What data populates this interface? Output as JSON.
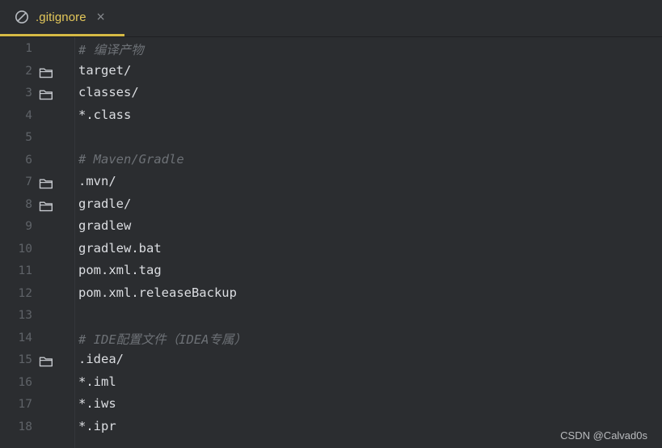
{
  "editor": {
    "tab": {
      "icon": "ignored-file-icon",
      "label": ".gitignore",
      "close": "×",
      "accent_color": "#d6ba45"
    },
    "lines": [
      {
        "number": "1",
        "text": "# 编译产物",
        "kind": "comment",
        "folder": false
      },
      {
        "number": "2",
        "text": "target/",
        "kind": "path",
        "folder": true
      },
      {
        "number": "3",
        "text": "classes/",
        "kind": "path",
        "folder": true
      },
      {
        "number": "4",
        "text": "*.class",
        "kind": "path",
        "folder": false
      },
      {
        "number": "5",
        "text": "",
        "kind": "blank",
        "folder": false
      },
      {
        "number": "6",
        "text": "# Maven/Gradle",
        "kind": "comment",
        "folder": false
      },
      {
        "number": "7",
        "text": ".mvn/",
        "kind": "path",
        "folder": true
      },
      {
        "number": "8",
        "text": "gradle/",
        "kind": "path",
        "folder": true
      },
      {
        "number": "9",
        "text": "gradlew",
        "kind": "path",
        "folder": false
      },
      {
        "number": "10",
        "text": "gradlew.bat",
        "kind": "path",
        "folder": false
      },
      {
        "number": "11",
        "text": "pom.xml.tag",
        "kind": "path",
        "folder": false
      },
      {
        "number": "12",
        "text": "pom.xml.releaseBackup",
        "kind": "path",
        "folder": false
      },
      {
        "number": "13",
        "text": "",
        "kind": "blank",
        "folder": false
      },
      {
        "number": "14",
        "text": "# IDE配置文件（IDEA专属）",
        "kind": "comment",
        "folder": false
      },
      {
        "number": "15",
        "text": ".idea/",
        "kind": "path",
        "folder": true
      },
      {
        "number": "16",
        "text": "*.iml",
        "kind": "path",
        "folder": false
      },
      {
        "number": "17",
        "text": "*.iws",
        "kind": "path",
        "folder": false
      },
      {
        "number": "18",
        "text": "*.ipr",
        "kind": "path",
        "folder": false
      }
    ]
  },
  "watermark": "CSDN @Calvad0s"
}
